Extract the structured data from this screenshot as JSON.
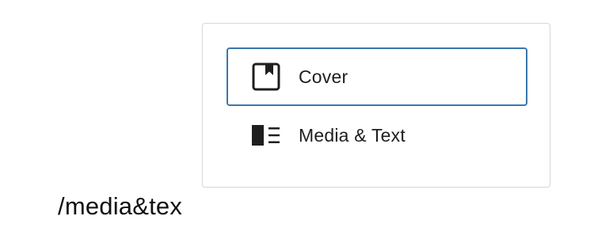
{
  "autocomplete": {
    "options": [
      {
        "label": "Cover",
        "icon": "cover-block-icon",
        "selected": true
      },
      {
        "label": "Media & Text",
        "icon": "media-text-block-icon",
        "selected": false
      }
    ]
  },
  "editor": {
    "typed_text": "/media&tex"
  },
  "colors": {
    "selection_border": "#3a77ab",
    "popover_border": "#d9d9d9",
    "text": "#1e1e1e"
  }
}
